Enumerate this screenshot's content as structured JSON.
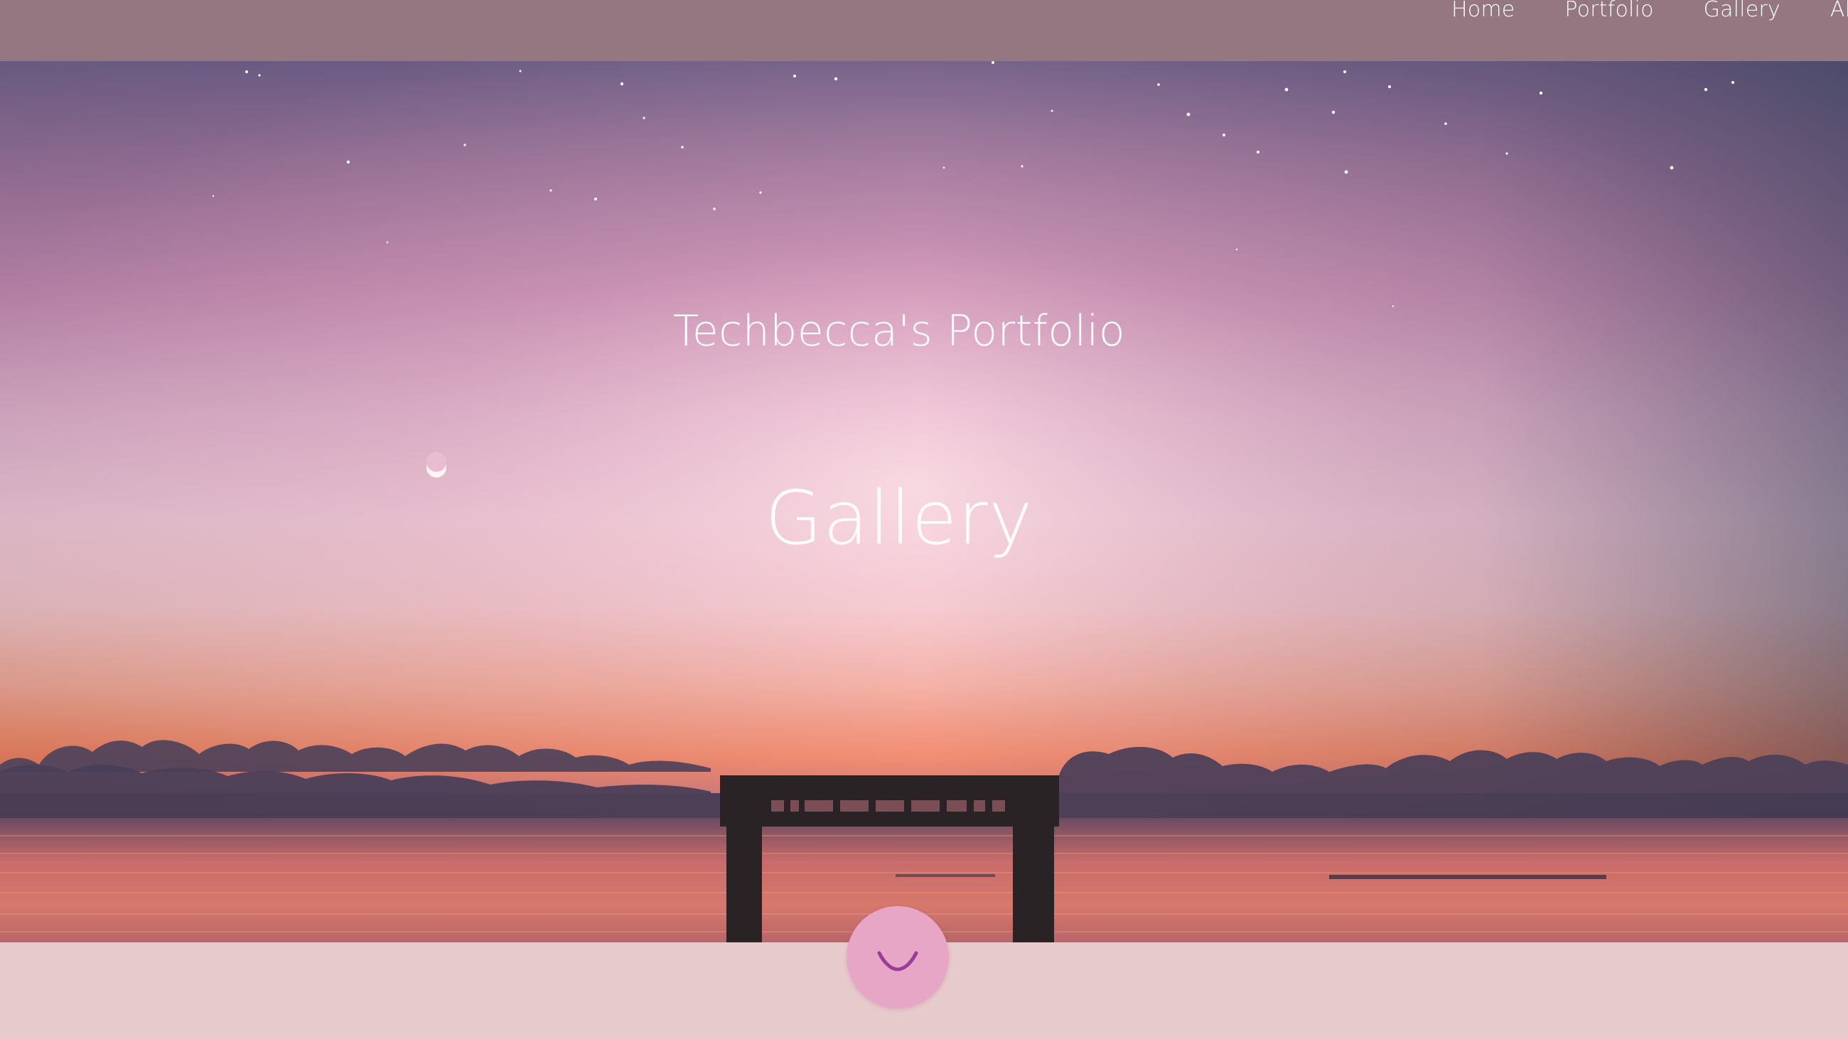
{
  "nav": {
    "items": [
      {
        "label": "Home"
      },
      {
        "label": "Portfolio"
      },
      {
        "label": "Gallery"
      },
      {
        "label": "About"
      }
    ]
  },
  "hero": {
    "site_title": "Techbecca's Portfolio",
    "heading": "Gallery",
    "background_icon": "sunset-pier-photo"
  },
  "scroll_button": {
    "icon": "chevron-down-icon"
  },
  "colors": {
    "navbar": "#957782",
    "footer_band": "#e7cacc",
    "scroll_button": "#e7a6c6",
    "chevron": "#9a3c9c"
  }
}
